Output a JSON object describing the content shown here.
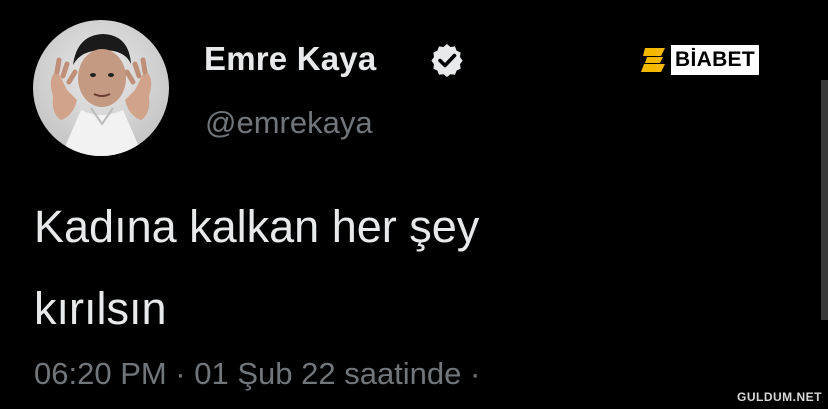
{
  "author": {
    "display_name": "Emre Kaya",
    "handle": "@emrekaya",
    "verified": true
  },
  "tweet": {
    "text": "Kadına kalkan her şey\nkırılsın",
    "timestamp": "06:20 PM · 01 Şub 22 saatinde ·"
  },
  "overlays": {
    "brand_logo_text": "BİABET",
    "watermark": "GULDUM.NET"
  },
  "icons": {
    "verified": "verified-badge-icon",
    "brand_mark": "brand-b-icon"
  },
  "colors": {
    "background": "#000000",
    "primary_text": "#e7e9ea",
    "secondary_text": "#71767b",
    "brand_accent": "#f5b800"
  }
}
